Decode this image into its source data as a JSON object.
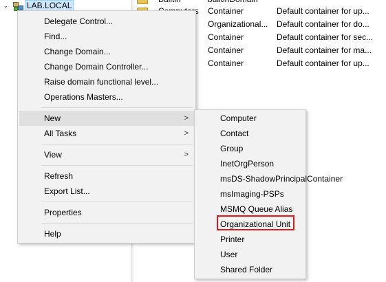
{
  "tree": {
    "expander_glyph": "⌄",
    "domain_label": "LAB.LOCAL"
  },
  "detail_rows": [
    {
      "name": "Builtin",
      "type": "builtinDomain",
      "description": ""
    },
    {
      "name": "Computers",
      "type": "Container",
      "description": "Default container for up..."
    },
    {
      "name": "",
      "type": "Organizational...",
      "description": "Default container for do..."
    },
    {
      "name": "",
      "type": "Container",
      "description": "Default container for sec..."
    },
    {
      "name": "",
      "type": "Container",
      "description": "Default container for ma..."
    },
    {
      "name": "",
      "type": "Container",
      "description": "Default container for up..."
    }
  ],
  "context_menu": {
    "items": [
      {
        "label": "Delegate Control..."
      },
      {
        "label": "Find..."
      },
      {
        "label": "Change Domain..."
      },
      {
        "label": "Change Domain Controller..."
      },
      {
        "label": "Raise domain functional level..."
      },
      {
        "label": "Operations Masters..."
      },
      {
        "label": "New",
        "has_submenu": true,
        "highlighted": true
      },
      {
        "label": "All Tasks",
        "has_submenu": true
      },
      {
        "label": "View",
        "has_submenu": true
      },
      {
        "label": "Refresh"
      },
      {
        "label": "Export List..."
      },
      {
        "label": "Properties"
      },
      {
        "label": "Help"
      }
    ],
    "submenu_arrow": ">"
  },
  "new_submenu": {
    "items": [
      {
        "label": "Computer"
      },
      {
        "label": "Contact"
      },
      {
        "label": "Group"
      },
      {
        "label": "InetOrgPerson"
      },
      {
        "label": "msDS-ShadowPrincipalContainer"
      },
      {
        "label": "msImaging-PSPs"
      },
      {
        "label": "MSMQ Queue Alias"
      },
      {
        "label": "Organizational Unit",
        "annotated": true
      },
      {
        "label": "Printer"
      },
      {
        "label": "User"
      },
      {
        "label": "Shared Folder"
      }
    ]
  },
  "colors": {
    "menu_background": "#f2f2f2",
    "highlight_row": "#e0e0e0",
    "annotation_box": "#e0191a",
    "selected_node": "#cce8ff"
  }
}
